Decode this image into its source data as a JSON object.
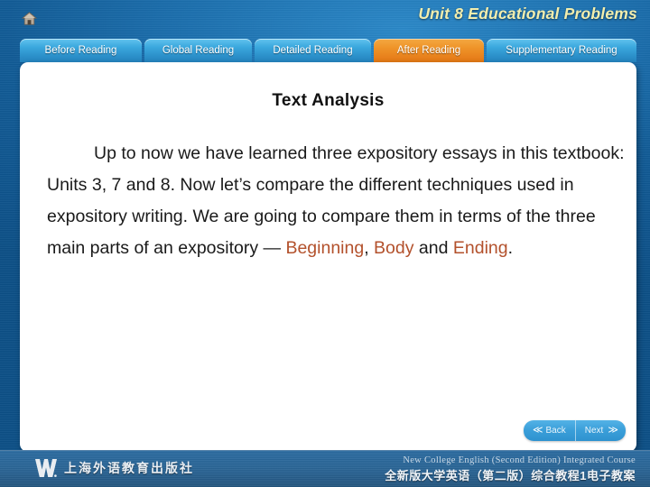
{
  "header": {
    "home_icon": "home-icon",
    "title": "Unit 8 Educational Problems"
  },
  "tabs": [
    {
      "label": "Before Reading",
      "active": false
    },
    {
      "label": "Global Reading",
      "active": false
    },
    {
      "label": "Detailed Reading",
      "active": false
    },
    {
      "label": "After Reading",
      "active": true
    },
    {
      "label": "Supplementary Reading",
      "active": false
    }
  ],
  "main": {
    "heading": "Text Analysis",
    "paragraph": {
      "part1": "Up to now we have learned three expository essays in this textbook: Units 3, 7 and 8. Now let’s compare the different techniques used in expository writing. We are going to compare them in terms of the three main parts of an expository — ",
      "highlight1": "Beginning",
      "sep1": ", ",
      "highlight2": "Body",
      "sep2": " and ",
      "highlight3": "Ending",
      "part_end": "."
    }
  },
  "nav": {
    "back_label": "Back",
    "next_label": "Next",
    "back_icon": "≪",
    "next_icon": "≫"
  },
  "footer": {
    "publisher_logo": "w-logo",
    "publisher_name": "上海外语教育出版社",
    "course_en": "New College English (Second Edition) Integrated Course",
    "course_cn": "全新版大学英语（第二版）综合教程1电子教案"
  },
  "colors": {
    "accent_tab_active": "#ef9429",
    "title_text": "#f2eeae",
    "highlight_text": "#b3512c",
    "panel_bg": "#ffffff"
  }
}
